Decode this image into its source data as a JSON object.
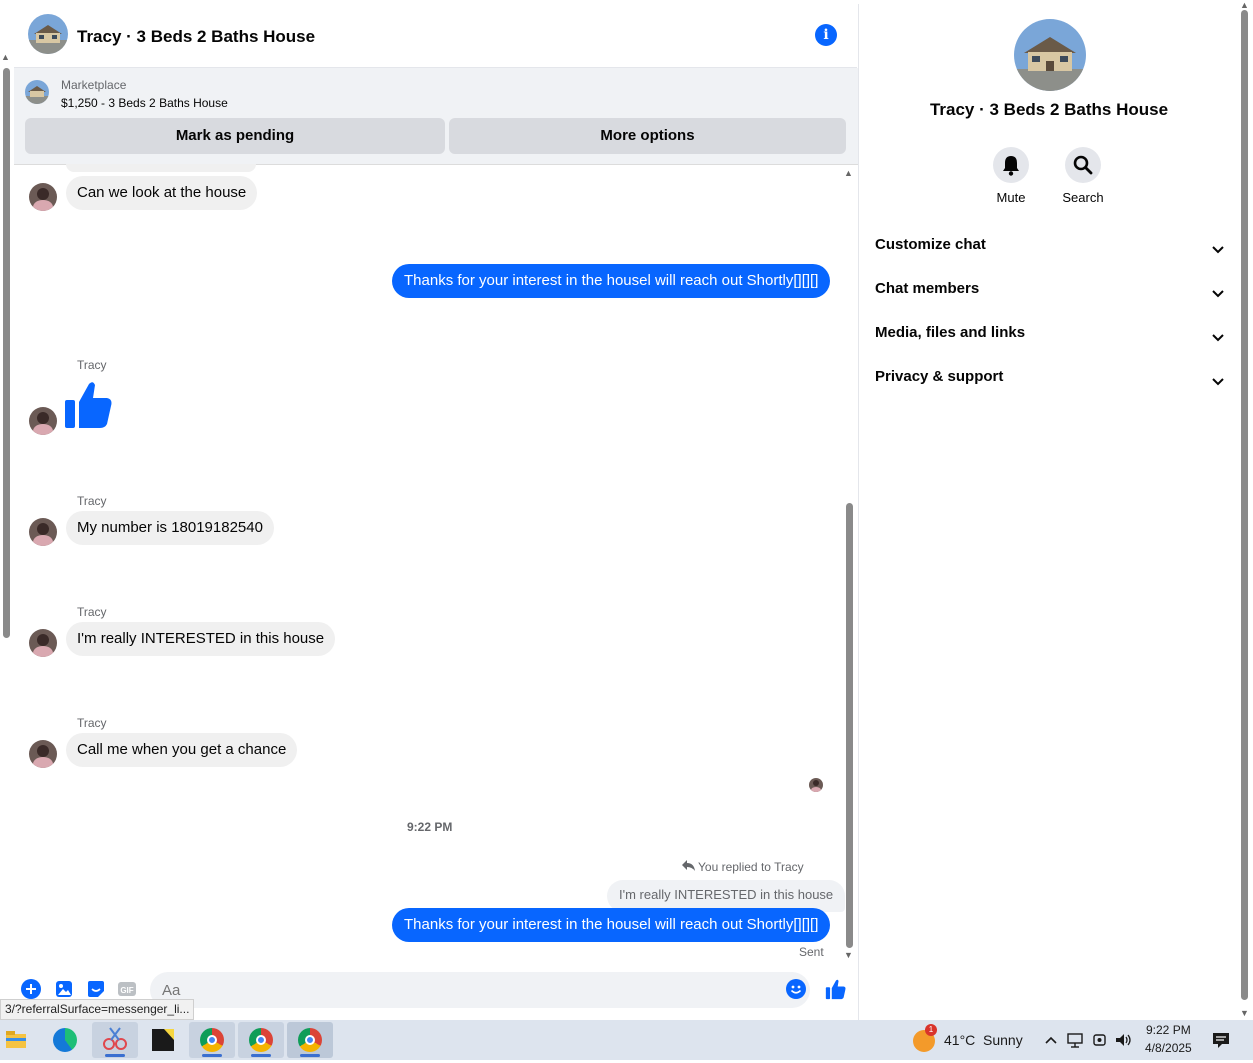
{
  "header": {
    "title": "Tracy · 3 Beds 2 Baths House",
    "info_icon": "info-icon"
  },
  "marketplace": {
    "category": "Marketplace",
    "listing": "$1,250 - 3 Beds 2 Baths House",
    "mark_pending": "Mark as pending",
    "more_options": "More options"
  },
  "messages": {
    "m1": "Can we look at the house",
    "m2": "Thanks for your interest in the housel will reach out Shortly[][][]",
    "sender": "Tracy",
    "m4": "My number is 18019182540",
    "m5": "I'm really INTERESTED in this house",
    "m6": "Call me when you get a chance",
    "time": "9:22 PM",
    "replied": "You replied to Tracy",
    "quote": "I'm really INTERESTED in this house",
    "m7": "Thanks for your interest in the housel will reach out Shortly[][][]",
    "status": "Sent"
  },
  "composer": {
    "placeholder": "Aa"
  },
  "info_pane": {
    "title": "Tracy · 3 Beds 2 Baths House",
    "mute": "Mute",
    "search": "Search",
    "sections": [
      "Customize chat",
      "Chat members",
      "Media, files and links",
      "Privacy & support"
    ]
  },
  "status_url": "3/?referralSurface=messenger_li...",
  "taskbar": {
    "badge": "1",
    "weather_temp": "41°C",
    "weather_text": "Sunny",
    "clock_time": "9:22 PM",
    "clock_date": "4/8/2025"
  },
  "colors": {
    "accent": "#0866ff",
    "bubble_in": "#f0f0f0",
    "banner": "#f0f2f5"
  }
}
